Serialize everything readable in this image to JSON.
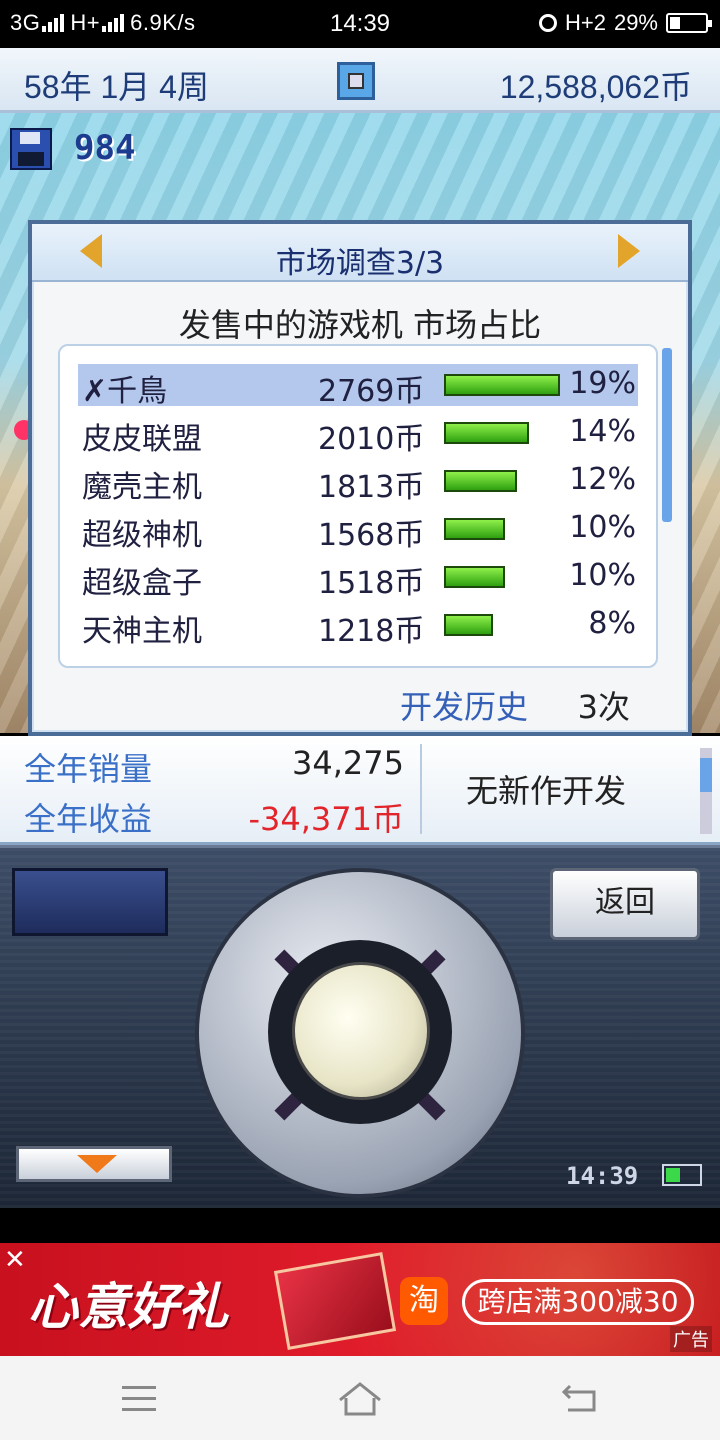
{
  "status_bar": {
    "network": "3G",
    "network2": "H+",
    "speed": "6.9K/s",
    "time": "14:39",
    "network3": "H+2",
    "battery": "29%"
  },
  "game_header": {
    "date": "58年 1月 4周",
    "money": "12,588,062币"
  },
  "scene": {
    "save_count": "984"
  },
  "dialog": {
    "title": "市场调查3/3",
    "subtitle": "发售中的游戏机 市场占比",
    "rows": [
      {
        "name": "✗千鳥",
        "price": "2769币",
        "share": "19%",
        "share_value": 19
      },
      {
        "name": "皮皮联盟",
        "price": "2010币",
        "share": "14%",
        "share_value": 14
      },
      {
        "name": "魔壳主机",
        "price": "1813币",
        "share": "12%",
        "share_value": 12
      },
      {
        "name": "超级神机",
        "price": "1568币",
        "share": "10%",
        "share_value": 10
      },
      {
        "name": "超级盒子",
        "price": "1518币",
        "share": "10%",
        "share_value": 10
      },
      {
        "name": "天神主机",
        "price": "1218币",
        "share": "8%",
        "share_value": 8
      }
    ],
    "history_label": "开发历史",
    "history_value": "3次"
  },
  "info": {
    "sales_label": "全年销量",
    "sales_value": "34,275",
    "revenue_label": "全年收益",
    "revenue_value": "-34,371币",
    "status": "无新作开发"
  },
  "controller": {
    "back_label": "返回",
    "clock": "14:39"
  },
  "ad": {
    "close": "✕",
    "title": "心意好礼",
    "taobao": "淘",
    "promo": "跨店满300减30",
    "label": "广告"
  },
  "colors": {
    "accent_blue": "#3a70c8",
    "negative_red": "#e2252b",
    "bar_green": "#2ea010"
  }
}
